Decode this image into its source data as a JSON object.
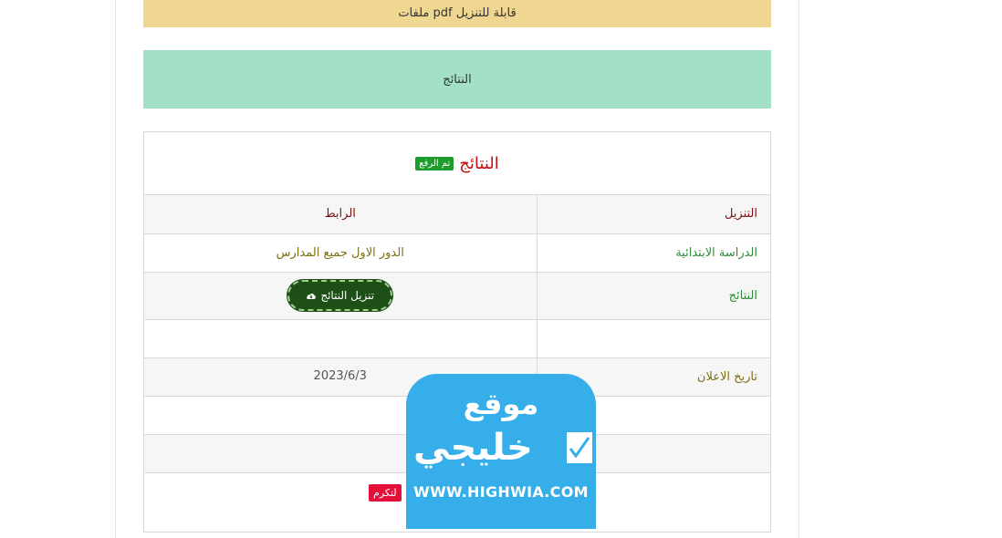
{
  "banner_top": {
    "label": "ملفات pdf قابلة للتنزيل"
  },
  "banner_results": {
    "label": "النتائج"
  },
  "results": {
    "title": "النتائج",
    "badge": "تم الرفع",
    "header": {
      "col_a": "التنزيل",
      "col_b": "الرابط"
    },
    "row_stage": {
      "col_a": "الدراسة الابتدائية",
      "col_b": "الدور الاول جميع المدارس"
    },
    "row_results": {
      "col_a": "النتائج",
      "button": "تنزيل النتائج"
    },
    "row_date": {
      "col_a": "تاريخ الاعلان",
      "col_b": "2023/6/3"
    },
    "share_pill": "لتكرم"
  },
  "watermark": {
    "top": "موقع",
    "mid": "خليجي",
    "url": "WWW.HIGHWIA.COM"
  },
  "colors": {
    "banner_yellow": "#efd791",
    "banner_green": "#a2e0c8",
    "button_green": "#1d4f17",
    "watermark_blue": "#35aeea"
  },
  "icons": {
    "download": "cloud-download-icon"
  }
}
